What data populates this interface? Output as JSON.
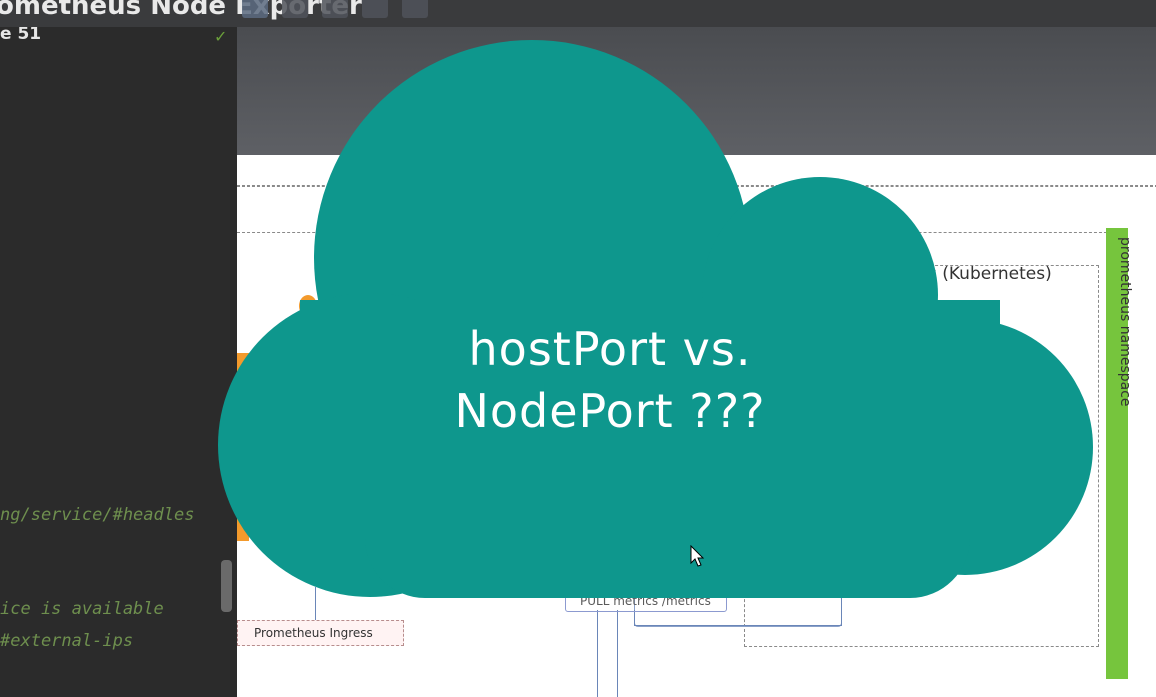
{
  "window": {
    "title": "ometheus Node Exporter"
  },
  "editor": {
    "file_label": "e 51",
    "code_lines": [
      "ng/service/#headles",
      "ice is available",
      "#external-ips"
    ]
  },
  "diagram": {
    "cluster_label": "rs (Kubernetes)",
    "namespace_label": "prometheus namespace",
    "ingress_label": "Prometheus Ingress",
    "pull_label": "PULL metrics /metrics"
  },
  "overlay": {
    "line1": "hostPort vs.",
    "line2": "NodePort ???",
    "cloud_color": "#0e978d"
  },
  "icons": [
    "zoom-in-icon",
    "zoom-out-icon",
    "zoom-fit-icon",
    "export-icon",
    "edit-icon",
    "checkmark-icon",
    "mouse-cursor-icon"
  ]
}
